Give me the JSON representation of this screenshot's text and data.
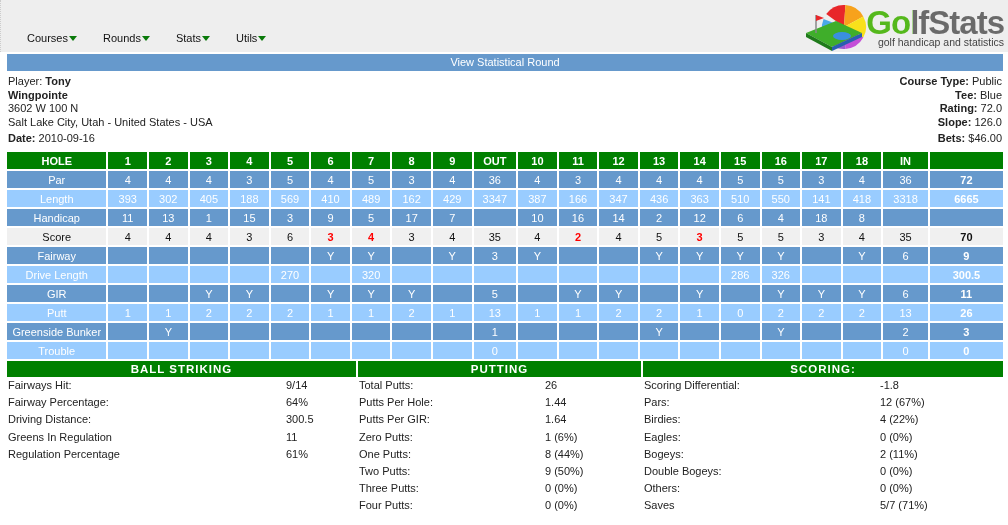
{
  "nav": [
    {
      "label": "Courses"
    },
    {
      "label": "Rounds"
    },
    {
      "label": "Stats"
    },
    {
      "label": "Utils"
    }
  ],
  "logo": {
    "name": "GolfStats",
    "tagline": "golf handicap and statistics"
  },
  "title_bar": "View Statistical Round",
  "info_left": {
    "player": "Player: **Tony Wingpointe**",
    "address": "3602 W 100 N",
    "city": "Salt Lake City, Utah - United States - USA",
    "date": "**Date:** 2010-09-16"
  },
  "info_right": [
    "**Course Type:** Public",
    "**Tee:** Blue",
    "**Rating:** 72.0",
    "**Slope:** 126.0",
    "**Bets:** $46.00"
  ],
  "scorecard": {
    "header": [
      "HOLE",
      "1",
      "2",
      "3",
      "4",
      "5",
      "6",
      "7",
      "8",
      "9",
      "OUT",
      "10",
      "11",
      "12",
      "13",
      "14",
      "15",
      "16",
      "17",
      "18",
      "IN"
    ],
    "rows": [
      {
        "label": "Par",
        "kind": "dark",
        "cells": [
          "4",
          "4",
          "4",
          "3",
          "5",
          "4",
          "5",
          "3",
          "4",
          "36",
          "4",
          "3",
          "4",
          "4",
          "4",
          "5",
          "5",
          "3",
          "4",
          "36",
          "72"
        ]
      },
      {
        "label": "Length",
        "kind": "light",
        "cells": [
          "393",
          "302",
          "405",
          "188",
          "569",
          "410",
          "489",
          "162",
          "429",
          "3347",
          "387",
          "166",
          "347",
          "436",
          "363",
          "510",
          "550",
          "141",
          "418",
          "3318",
          "6665"
        ]
      },
      {
        "label": "Handicap",
        "kind": "dark",
        "cells": [
          "11",
          "13",
          "1",
          "15",
          "3",
          "9",
          "5",
          "17",
          "7",
          null,
          "10",
          "16",
          "14",
          "2",
          "12",
          "6",
          "4",
          "18",
          "8",
          null,
          null
        ]
      },
      {
        "label": "Score",
        "kind": "score",
        "cells": [
          {
            "text": "4",
            "birdie": false
          },
          {
            "text": "4",
            "birdie": false
          },
          {
            "text": "4",
            "birdie": false
          },
          {
            "text": "3",
            "birdie": false
          },
          {
            "text": "6",
            "birdie": false
          },
          {
            "text": "3",
            "birdie": true
          },
          {
            "text": "4",
            "birdie": true
          },
          {
            "text": "3",
            "birdie": false
          },
          {
            "text": "4",
            "birdie": false
          },
          {
            "text": "35",
            "birdie": false
          },
          {
            "text": "4",
            "birdie": false
          },
          {
            "text": "2",
            "birdie": true
          },
          {
            "text": "4",
            "birdie": false
          },
          {
            "text": "5",
            "birdie": false
          },
          {
            "text": "3",
            "birdie": true
          },
          {
            "text": "5",
            "birdie": false
          },
          {
            "text": "5",
            "birdie": false
          },
          {
            "text": "3",
            "birdie": false
          },
          {
            "text": "4",
            "birdie": false
          },
          {
            "text": "35",
            "birdie": false
          },
          {
            "text": "70",
            "birdie": false
          }
        ]
      },
      {
        "label": "Fairway",
        "kind": "dark",
        "cells": [
          null,
          null,
          null,
          null,
          null,
          "Y",
          "Y",
          null,
          "Y",
          "3",
          "Y",
          null,
          null,
          "Y",
          "Y",
          "Y",
          "Y",
          null,
          "Y",
          "6",
          "9"
        ]
      },
      {
        "label": "Drive Length",
        "kind": "light",
        "cells": [
          null,
          null,
          null,
          null,
          "270",
          null,
          "320",
          null,
          null,
          null,
          null,
          null,
          null,
          null,
          null,
          "286",
          "326",
          null,
          null,
          null,
          "300.5"
        ]
      },
      {
        "label": "GIR",
        "kind": "dark",
        "cells": [
          null,
          null,
          "Y",
          "Y",
          null,
          "Y",
          "Y",
          "Y",
          null,
          "5",
          null,
          "Y",
          "Y",
          null,
          "Y",
          null,
          "Y",
          "Y",
          "Y",
          "6",
          "11"
        ]
      },
      {
        "label": "Putt",
        "kind": "light",
        "cells": [
          "1",
          "1",
          "2",
          "2",
          "2",
          "1",
          "1",
          "2",
          "1",
          "13",
          "1",
          "1",
          "2",
          "2",
          "1",
          "0",
          "2",
          "2",
          "2",
          "13",
          "26"
        ]
      },
      {
        "label": "Greenside Bunker",
        "kind": "dark",
        "cells": [
          null,
          "Y",
          null,
          null,
          null,
          null,
          null,
          null,
          null,
          "1",
          null,
          null,
          null,
          "Y",
          null,
          null,
          "Y",
          null,
          null,
          "2",
          "3"
        ]
      },
      {
        "label": "Trouble",
        "kind": "light",
        "cells": [
          null,
          null,
          null,
          null,
          null,
          null,
          null,
          null,
          null,
          "0",
          null,
          null,
          null,
          null,
          null,
          null,
          null,
          null,
          null,
          "0",
          "0"
        ]
      }
    ]
  },
  "sections": [
    {
      "title": "BALL STRIKING",
      "rows": [
        [
          "Fairways Hit:",
          "9/14"
        ],
        [
          "Fairway Percentage:",
          "64%"
        ],
        [
          "Driving Distance:",
          "300.5"
        ],
        [
          "Greens In Regulation",
          "11"
        ],
        [
          "Regulation Percentage",
          "61%"
        ]
      ]
    },
    {
      "title": "PUTTING",
      "rows": [
        [
          "Total Putts:",
          "26"
        ],
        [
          "Putts Per Hole:",
          "1.44"
        ],
        [
          "Putts Per GIR:",
          "1.64"
        ],
        [
          "Zero Putts:",
          "1 (6%)"
        ],
        [
          "One Putts:",
          "8 (44%)"
        ],
        [
          "Two Putts:",
          "9 (50%)"
        ],
        [
          "Three Putts:",
          "0 (0%)"
        ],
        [
          "Four Putts:",
          "0 (0%)"
        ]
      ]
    },
    {
      "title": "SCORING:",
      "rows": [
        [
          "Scoring Differential:",
          "-1.8"
        ],
        [
          "Pars:",
          "12 (67%)"
        ],
        [
          "Birdies:",
          "4 (22%)"
        ],
        [
          "Eagles:",
          "0 (0%)"
        ],
        [
          "Bogeys:",
          "2 (11%)"
        ],
        [
          "Double Bogeys:",
          "0 (0%)"
        ],
        [
          "Others:",
          "0 (0%)"
        ],
        [
          "Saves",
          "5/7 (71%)"
        ]
      ]
    }
  ]
}
